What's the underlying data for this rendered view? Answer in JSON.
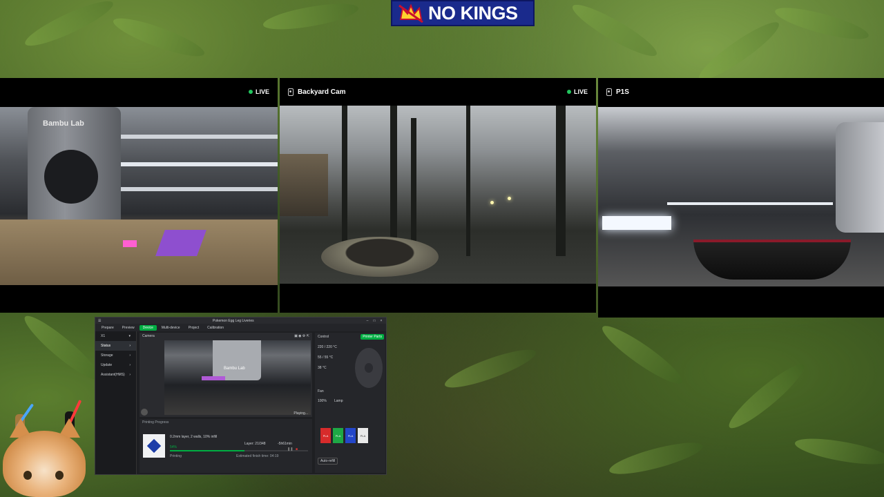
{
  "banner": {
    "text": "NO KINGS"
  },
  "cameras": [
    {
      "title": "",
      "live_label": "LIVE",
      "is_live": true
    },
    {
      "title": "Backyard Cam",
      "live_label": "LIVE",
      "is_live": true
    },
    {
      "title": "P1S",
      "live_label": "",
      "is_live": false
    }
  ],
  "printer_label": "Bambu Lab",
  "app": {
    "window_title": "Pokemon Egg Leg Liveries",
    "menu_tabs": [
      "Prepare",
      "Preview",
      "Device",
      "Multi-device",
      "Project",
      "Calibration"
    ],
    "active_tab": "Device",
    "device_name": "X1",
    "sidebar": [
      "Status",
      "Storage",
      "Update",
      "Assistant(HMS)"
    ],
    "camera_label": "Camera",
    "playing_label": "Playing...",
    "progress_header": "Printing Progress",
    "job_description": "0.2mm layer, 2 walls, 10% infill",
    "progress_percent": "54%",
    "progress_fraction": 0.54,
    "status_text": "Printing",
    "layer_text": "Layer: 21/348",
    "remaining_text": "-5h61min",
    "finish_text": "Estimated finish time: 04:19",
    "control_label": "Control",
    "printer_parts_button": "Printer Parts",
    "temps": [
      "220 / 220 °C",
      "55 / 55 °C",
      "38 °C"
    ],
    "fan_label": "Fan",
    "lamp_label": "Lamp",
    "speed_label": "100%",
    "ams_spools": [
      {
        "label": "PLA",
        "color": "#d72b2b"
      },
      {
        "label": "PLA",
        "color": "#1ea845"
      },
      {
        "label": "PLA",
        "color": "#2447c9"
      },
      {
        "label": "PLA",
        "color": "#e9e9e9"
      }
    ],
    "auto_refill": "Auto-refill"
  },
  "colors": {
    "accent": "#00ae42",
    "live_dot": "#22c55e",
    "banner_bg": "#1a2a8c"
  }
}
